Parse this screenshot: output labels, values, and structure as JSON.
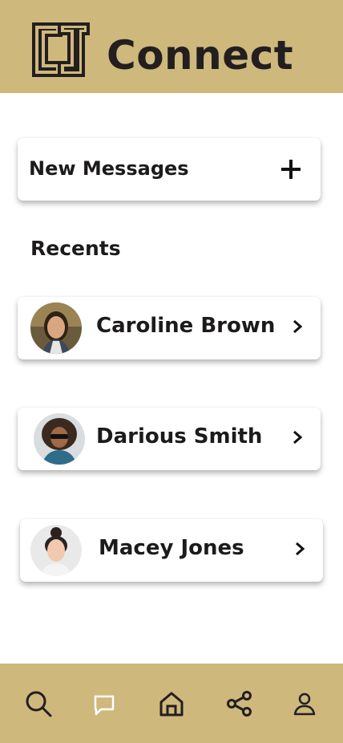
{
  "header": {
    "title": "Connect",
    "logo_text": "CU"
  },
  "new_message": {
    "label": "New Messages"
  },
  "recents": {
    "heading": "Recents",
    "contacts": [
      {
        "name": "Caroline Brown"
      },
      {
        "name": "Darious Smith"
      },
      {
        "name": "Macey Jones"
      }
    ]
  },
  "bottom_nav": {
    "items": [
      {
        "icon": "search-icon",
        "active": false
      },
      {
        "icon": "chat-icon",
        "active": true
      },
      {
        "icon": "home-icon",
        "active": false
      },
      {
        "icon": "share-icon",
        "active": false
      },
      {
        "icon": "profile-icon",
        "active": false
      }
    ]
  },
  "colors": {
    "accent": "#cfb87c",
    "text": "#231f20",
    "active_icon": "#ffffff"
  }
}
